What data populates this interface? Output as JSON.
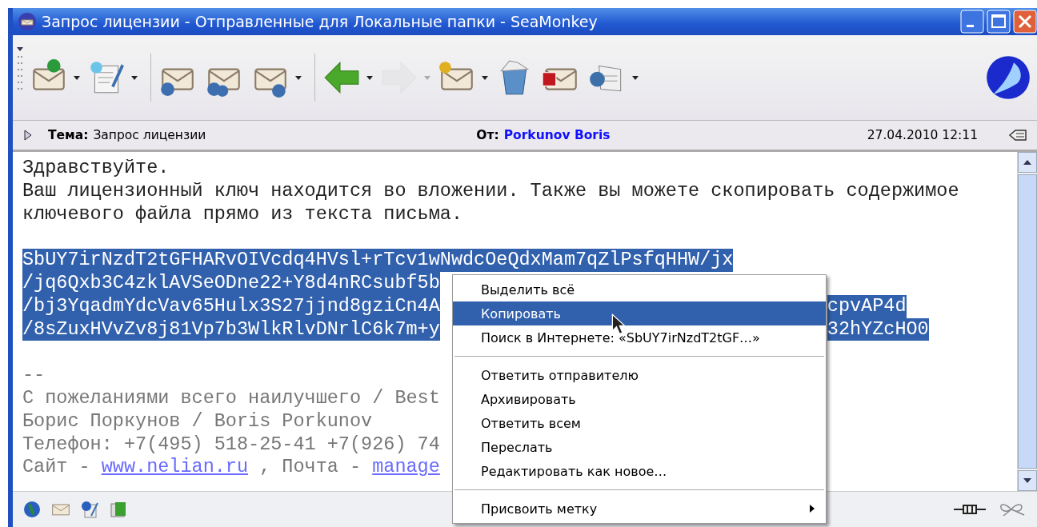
{
  "window": {
    "title": "Запрос лицензии - Отправленные для Локальные папки - SeaMonkey"
  },
  "toolbar": [
    {
      "kind": "get-mail",
      "menu": true,
      "disabled": false
    },
    {
      "kind": "compose",
      "menu": true,
      "disabled": false
    },
    {
      "kind": "separator"
    },
    {
      "kind": "reply",
      "menu": false,
      "disabled": false
    },
    {
      "kind": "reply-all",
      "menu": false,
      "disabled": false
    },
    {
      "kind": "forward",
      "menu": true,
      "disabled": false
    },
    {
      "kind": "separator"
    },
    {
      "kind": "back",
      "menu": true,
      "disabled": false
    },
    {
      "kind": "next",
      "menu": true,
      "disabled": true
    },
    {
      "kind": "mark",
      "menu": true,
      "disabled": false
    },
    {
      "kind": "file",
      "menu": false,
      "disabled": false
    },
    {
      "kind": "delete",
      "menu": false,
      "disabled": false
    },
    {
      "kind": "new-doc",
      "menu": true,
      "disabled": false
    }
  ],
  "header": {
    "subject_label": "Тема:",
    "subject": "Запрос лицензии",
    "from_label": "От:",
    "from": "Porkunov Boris",
    "date": "27.04.2010 12:11"
  },
  "body": {
    "greeting": [
      "Здравствуйте.",
      "Ваш лицензионный ключ находится во вложении. Также вы можете скопировать содержимое",
      "ключевого файла прямо из текста письма."
    ],
    "key_lines": [
      {
        "text": "SbUY7irNzdT2tGFHARvOIVcdq4HVsl+rTcv1wNwdcOeQdxMam7qZlPsfqHHW/jx"
      },
      {
        "text": "/jq6Qxb3C4zklAVSeODne22+Y8d4nRCsubf5b"
      },
      {
        "text": "/bj3YqadmYdcVav65Hulx3S27jjnd8gziCn4A",
        "tail": "cpvAP4d"
      },
      {
        "text": "/8sZuxHVvZv8j81Vp7b3WlkRlvDNrlC6k7m+y",
        "tail": "32hYZcHO0"
      }
    ],
    "signature": [
      {
        "text": "--"
      },
      {
        "text": "С пожеланиями всего наилучшего / Best"
      },
      {
        "text": "Борис Поркунов / Boris Porkunov"
      },
      {
        "text": "Телефон: +7(495) 518-25-41 +7(926) 74"
      },
      {
        "text": "Сайт - ",
        "link": "www.nelian.ru",
        "after": " , Почта - ",
        "link2": "manage"
      }
    ]
  },
  "context_menu": [
    {
      "kind": "item",
      "label": "Выделить всё",
      "selected": false,
      "submenu": false
    },
    {
      "kind": "item",
      "label": "Копировать",
      "selected": true,
      "submenu": false
    },
    {
      "kind": "item",
      "label": "Поиск в Интернете: «SbUY7irNzdT2tGF…»",
      "selected": false,
      "submenu": false
    },
    {
      "kind": "separator"
    },
    {
      "kind": "item",
      "label": "Ответить отправителю",
      "selected": false,
      "submenu": false
    },
    {
      "kind": "item",
      "label": "Архивировать",
      "selected": false,
      "submenu": false
    },
    {
      "kind": "item",
      "label": "Ответить всем",
      "selected": false,
      "submenu": false
    },
    {
      "kind": "item",
      "label": "Переслать",
      "selected": false,
      "submenu": false
    },
    {
      "kind": "item",
      "label": "Редактировать как новое…",
      "selected": false,
      "submenu": false
    },
    {
      "kind": "separator"
    },
    {
      "kind": "item",
      "label": "Присвоить метку",
      "selected": false,
      "submenu": true
    }
  ]
}
